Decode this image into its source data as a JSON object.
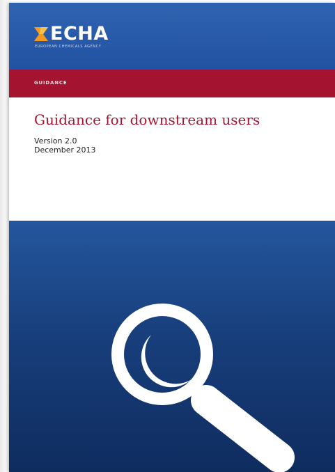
{
  "organization": {
    "logo_name": "ECHA",
    "logo_subtitle": "EUROPEAN CHEMICALS AGENCY"
  },
  "category_band": {
    "label": "GUIDANCE"
  },
  "document": {
    "title": "Guidance for downstream users",
    "version": "Version 2.0",
    "date": "December 2013"
  },
  "colors": {
    "header_blue": "#2f63b0",
    "band_red": "#a41431",
    "title_red": "#a41431",
    "lower_navy": "#183f7c",
    "logo_orange": "#f29a1f"
  },
  "icons": {
    "logo_mark": "echa-logo-mark-icon",
    "magnifier": "magnifying-glass-icon"
  }
}
